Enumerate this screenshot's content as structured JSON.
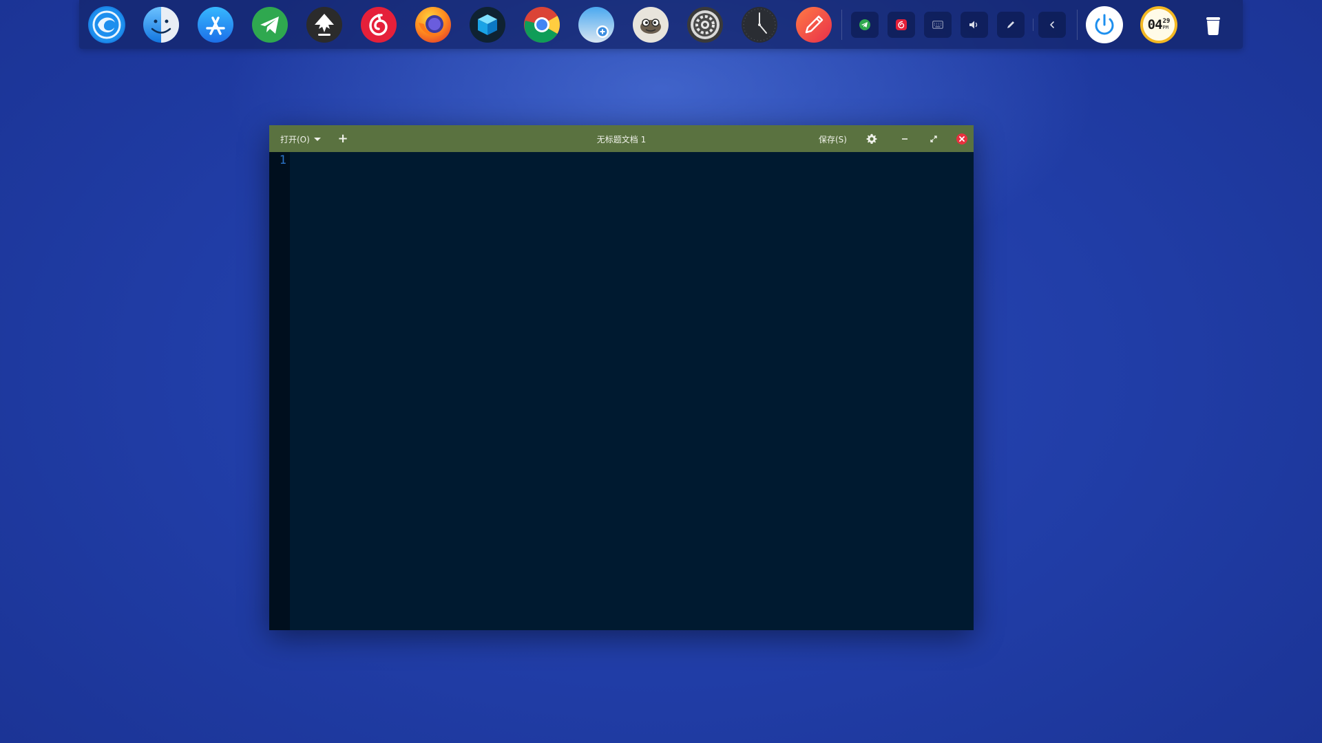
{
  "dock": {
    "apps": [
      {
        "name": "deepin-launcher",
        "icon": "deepin-logo-icon"
      },
      {
        "name": "file-manager",
        "icon": "finder-face-icon"
      },
      {
        "name": "app-store",
        "icon": "app-store-icon"
      },
      {
        "name": "telegram",
        "icon": "paper-plane-icon"
      },
      {
        "name": "inkscape",
        "icon": "inkscape-icon"
      },
      {
        "name": "netease-music",
        "icon": "netease-music-icon"
      },
      {
        "name": "firefox",
        "icon": "firefox-icon"
      },
      {
        "name": "box-app",
        "icon": "cube-icon"
      },
      {
        "name": "chrome",
        "icon": "chrome-icon"
      },
      {
        "name": "screenshot-app",
        "icon": "camera-plus-icon"
      },
      {
        "name": "gimp",
        "icon": "gimp-icon"
      },
      {
        "name": "system-settings",
        "icon": "gear-icon"
      },
      {
        "name": "clock",
        "icon": "clock-icon"
      },
      {
        "name": "text-editor",
        "icon": "pencil-icon"
      }
    ],
    "tray": [
      {
        "name": "telegram-tray",
        "icon": "telegram-tray-icon"
      },
      {
        "name": "netease-tray",
        "icon": "netease-tray-icon"
      },
      {
        "name": "keyboard-tray",
        "icon": "keyboard-icon"
      },
      {
        "name": "volume-tray",
        "icon": "volume-icon"
      },
      {
        "name": "pen-tray",
        "icon": "pen-icon"
      },
      {
        "name": "tray-collapse",
        "icon": "chevron-left-icon"
      }
    ],
    "power": {
      "icon": "power-icon"
    },
    "clock_widget": {
      "hours": "04",
      "minutes": "29",
      "period": "PM"
    },
    "trash": {
      "icon": "trash-icon"
    }
  },
  "editor": {
    "menu_open_label": "打开(O)",
    "new_tab_label": "+",
    "document_title": "无标题文档 1",
    "save_label": "保存(S)",
    "line_numbers": [
      "1"
    ],
    "content": "",
    "colors": {
      "titlebar": "#5a7240",
      "background": "#001a30",
      "gutter": "#000f1e",
      "line_number": "#2a73c8",
      "close_button": "#e8313f"
    }
  }
}
